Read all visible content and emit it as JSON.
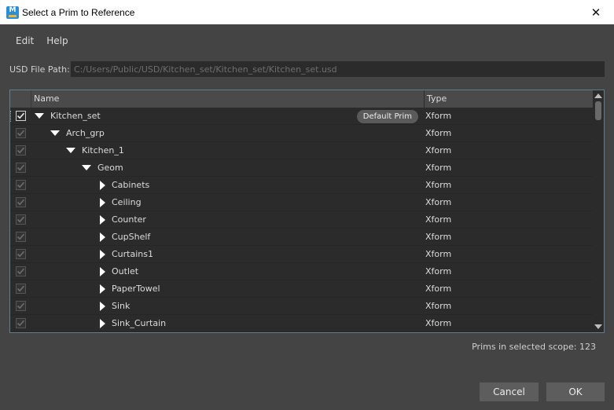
{
  "window": {
    "title": "Select a Prim to Reference",
    "app_icon": "maya-icon",
    "close_glyph": "✕"
  },
  "menu": {
    "items": [
      "Edit",
      "Help"
    ]
  },
  "path": {
    "label": "USD File Path:",
    "value": "C:/Users/Public/USD/Kitchen_set/Kitchen_set/Kitchen_set.usd"
  },
  "tree": {
    "columns": {
      "name": "Name",
      "type": "Type"
    },
    "default_badge": "Default Prim",
    "rows": [
      {
        "name": "Kitchen_set",
        "type": "Xform",
        "depth": 0,
        "expanded": true,
        "checked": true,
        "enabled": true,
        "default_prim": true
      },
      {
        "name": "Arch_grp",
        "type": "Xform",
        "depth": 1,
        "expanded": true,
        "checked": true,
        "enabled": false
      },
      {
        "name": "Kitchen_1",
        "type": "Xform",
        "depth": 2,
        "expanded": true,
        "checked": true,
        "enabled": false
      },
      {
        "name": "Geom",
        "type": "Xform",
        "depth": 3,
        "expanded": true,
        "checked": true,
        "enabled": false
      },
      {
        "name": "Cabinets",
        "type": "Xform",
        "depth": 4,
        "expanded": false,
        "checked": true,
        "enabled": false
      },
      {
        "name": "Ceiling",
        "type": "Xform",
        "depth": 4,
        "expanded": false,
        "checked": true,
        "enabled": false
      },
      {
        "name": "Counter",
        "type": "Xform",
        "depth": 4,
        "expanded": false,
        "checked": true,
        "enabled": false
      },
      {
        "name": "CupShelf",
        "type": "Xform",
        "depth": 4,
        "expanded": false,
        "checked": true,
        "enabled": false
      },
      {
        "name": "Curtains1",
        "type": "Xform",
        "depth": 4,
        "expanded": false,
        "checked": true,
        "enabled": false
      },
      {
        "name": "Outlet",
        "type": "Xform",
        "depth": 4,
        "expanded": false,
        "checked": true,
        "enabled": false
      },
      {
        "name": "PaperTowel",
        "type": "Xform",
        "depth": 4,
        "expanded": false,
        "checked": true,
        "enabled": false
      },
      {
        "name": "Sink",
        "type": "Xform",
        "depth": 4,
        "expanded": false,
        "checked": true,
        "enabled": false
      },
      {
        "name": "Sink_Curtain",
        "type": "Xform",
        "depth": 4,
        "expanded": false,
        "checked": true,
        "enabled": false
      }
    ]
  },
  "scope": {
    "label": "Prims in selected scope:",
    "count": "123"
  },
  "buttons": {
    "cancel": "Cancel",
    "ok": "OK"
  },
  "colors": {
    "background": "#444444",
    "field": "#2b2b2b",
    "tree_border": "#5f7e91",
    "button": "#5d5d5d"
  }
}
